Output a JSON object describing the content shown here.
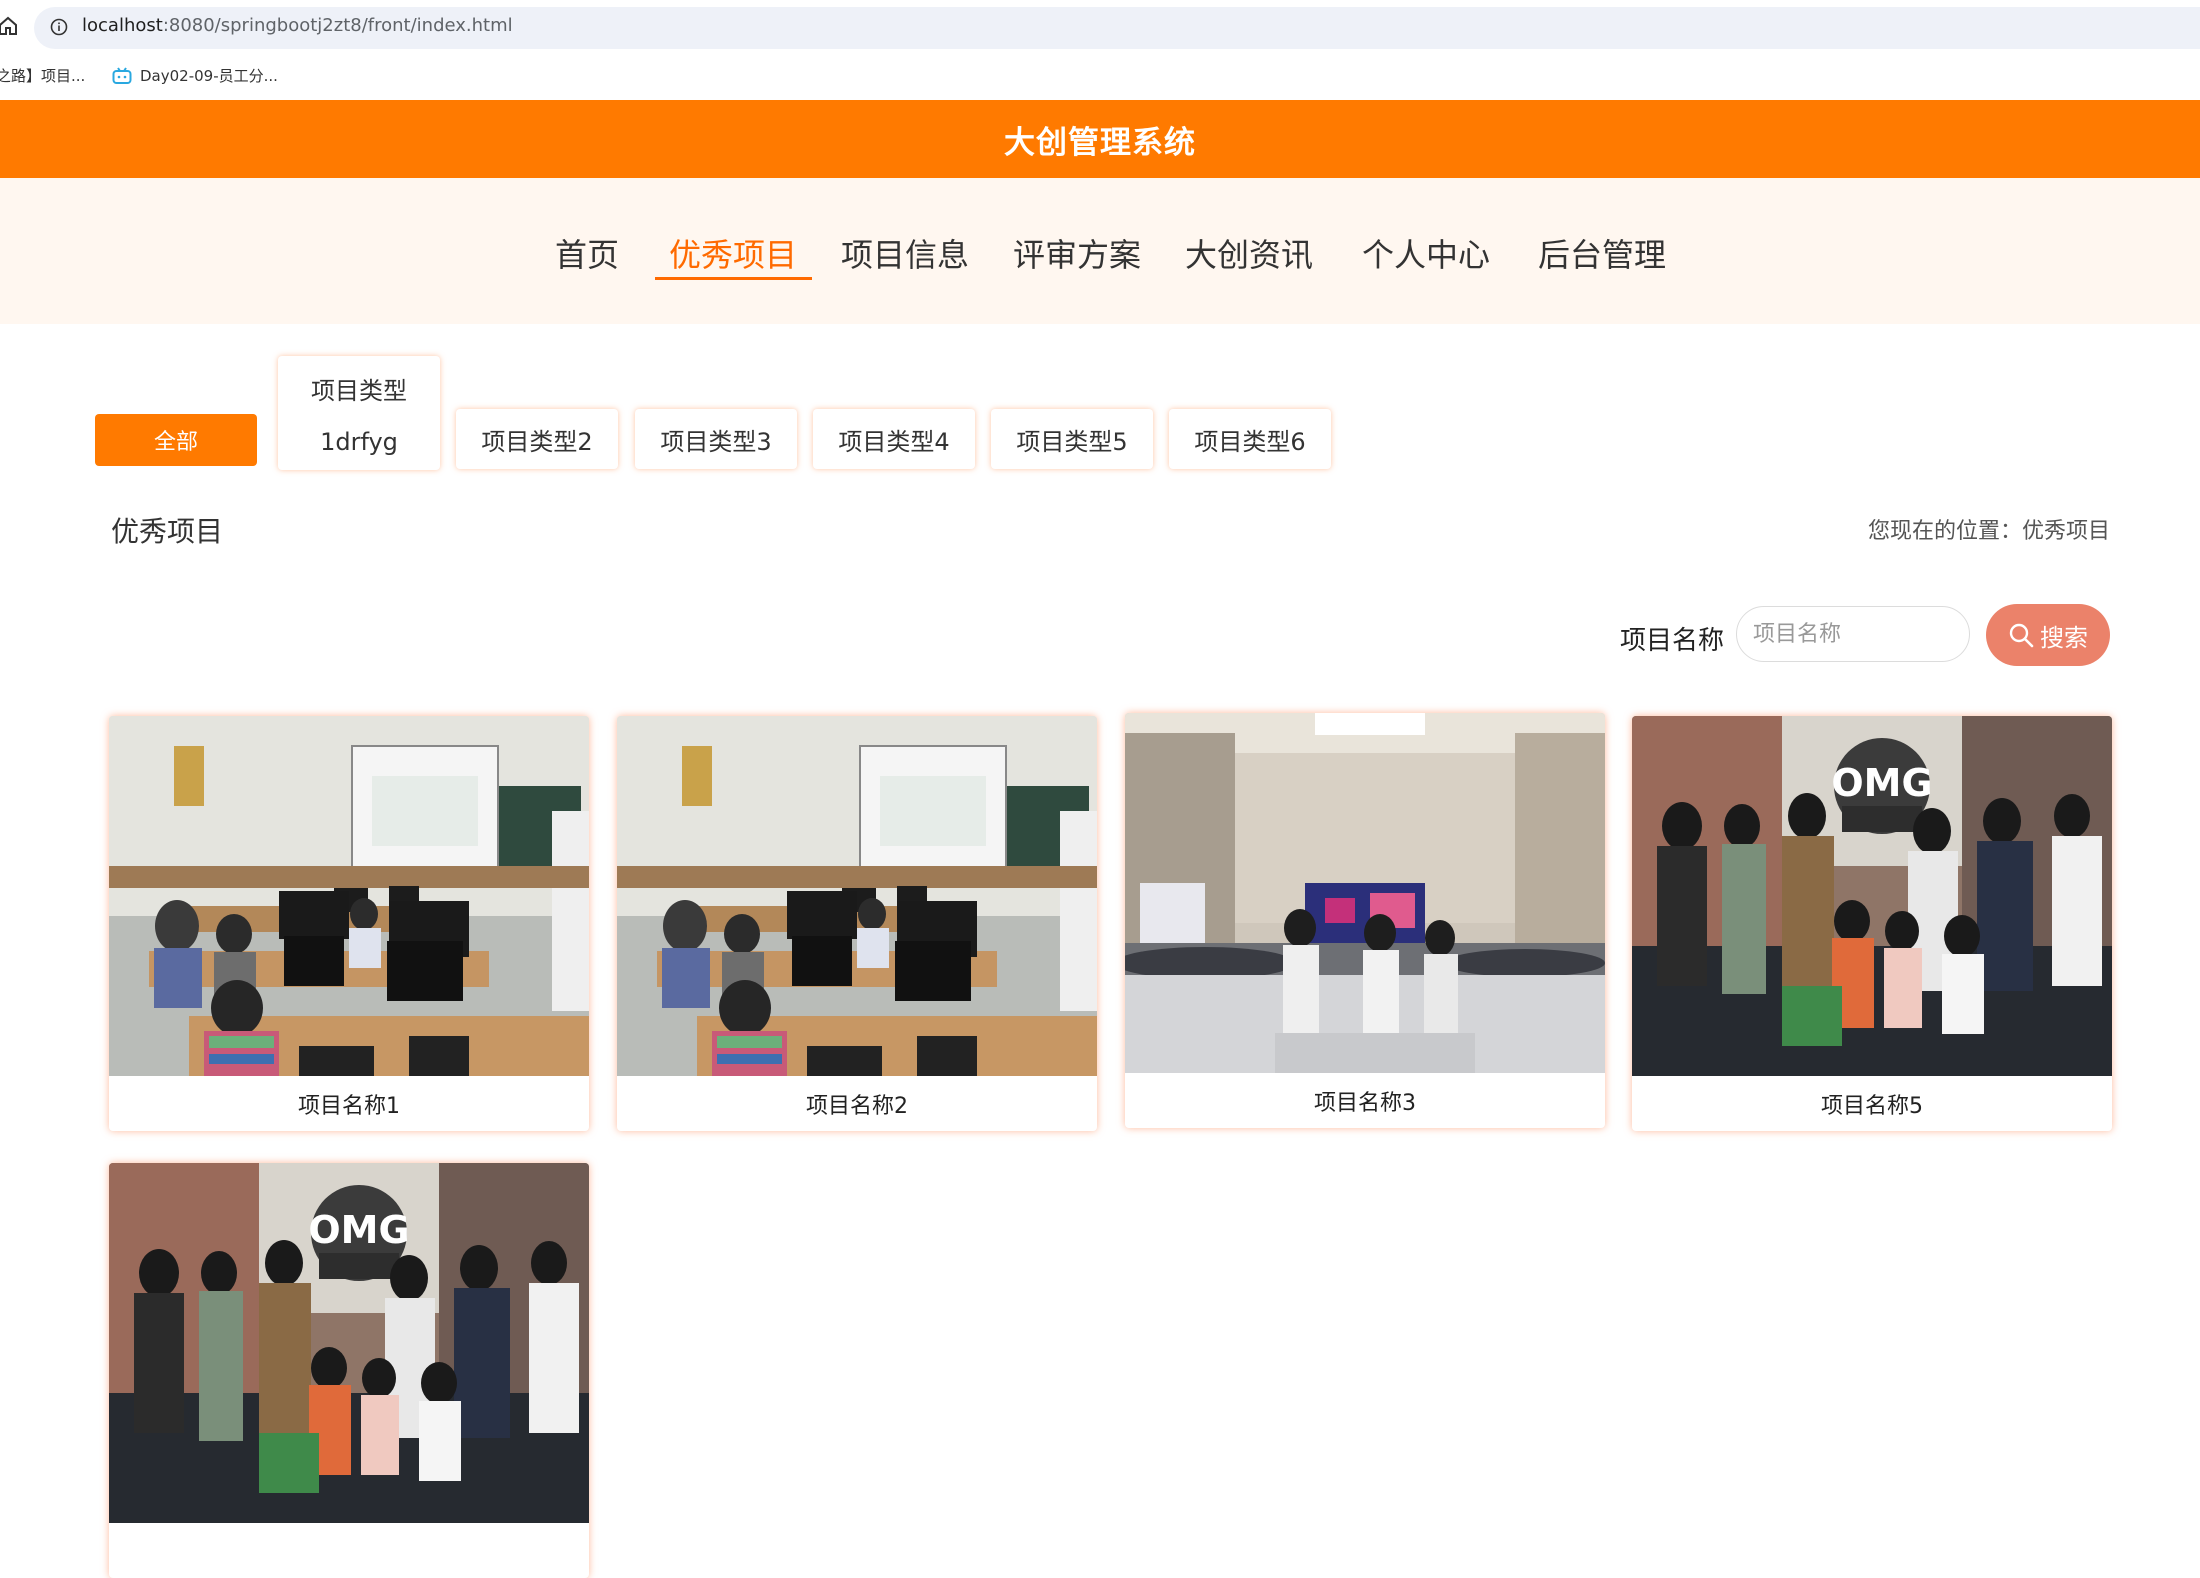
{
  "browser": {
    "url_host": "localhost",
    "url_rest": ":8080/springbootj2zt8/front/index.html",
    "bookmarks": [
      {
        "label": "之路】项目..."
      },
      {
        "label": "Day02-09-员工分..."
      }
    ]
  },
  "header": {
    "title": "大创管理系统"
  },
  "nav": {
    "items": [
      {
        "label": "首页"
      },
      {
        "label": "优秀项目"
      },
      {
        "label": "项目信息"
      },
      {
        "label": "评审方案"
      },
      {
        "label": "大创资讯"
      },
      {
        "label": "个人中心"
      },
      {
        "label": "后台管理"
      }
    ],
    "active": "优秀项目"
  },
  "categories": {
    "all": "全部",
    "items": [
      {
        "line1": "项目类型",
        "line2": "1drfyg"
      },
      {
        "label": "项目类型2"
      },
      {
        "label": "项目类型3"
      },
      {
        "label": "项目类型4"
      },
      {
        "label": "项目类型5"
      },
      {
        "label": "项目类型6"
      }
    ]
  },
  "section": {
    "title": "优秀项目",
    "breadcrumb": "您现在的位置：优秀项目"
  },
  "search": {
    "label": "项目名称",
    "placeholder": "项目名称",
    "button": "搜索"
  },
  "projects": [
    {
      "name": "项目名称1",
      "image": "classroom-photo"
    },
    {
      "name": "项目名称2",
      "image": "classroom-photo"
    },
    {
      "name": "项目名称3",
      "image": "conference-hall-photo"
    },
    {
      "name": "项目名称5",
      "image": "group-photo-omg"
    },
    {
      "name": "",
      "image": "group-photo-omg"
    }
  ],
  "colors": {
    "brand": "#ff7a00",
    "nav_bg": "#fff7f0",
    "search_button": "#eb826a"
  }
}
